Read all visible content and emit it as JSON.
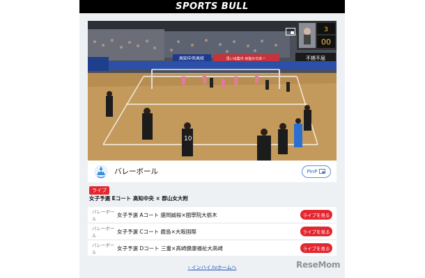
{
  "brand": {
    "logo_text": "SPORTS BULL"
  },
  "video": {
    "banner_left": "高知中央高校",
    "banner_mid": "思い出集中 目指せ日本一",
    "banner_right": "不撓不屈",
    "scoreboard_sets": "3",
    "scoreboard_points": "00"
  },
  "event": {
    "sport_title": "バレーボール",
    "pinp_label": "PinP"
  },
  "live": {
    "badge": "ライブ",
    "title": "女子予選 Eコート 高知中央 × 郡山女大附"
  },
  "matches": [
    {
      "category": "バレーボール",
      "name": "女子予選 Aコート 盛岡誠桜×國學院大栃木",
      "button": "ライブを見る"
    },
    {
      "category": "バレーボール",
      "name": "女子予選 Cコート 鹿島×大阪国際",
      "button": "ライブを見る"
    },
    {
      "category": "バレーボール",
      "name": "女子予選 Dコート 三重×高崎健康福祉大高崎",
      "button": "ライブを見る"
    }
  ],
  "footer": {
    "home_link": "インハイ.tvホームへ"
  },
  "watermark": "ReseMom",
  "colors": {
    "accent_red": "#e3262f",
    "link_blue": "#1b4fb3",
    "court_floor": "#c49a5c",
    "top_bar": "#000000"
  },
  "icons": [
    "pip-icon",
    "volleyball-mascot-icon",
    "chevron-left-icon"
  ]
}
